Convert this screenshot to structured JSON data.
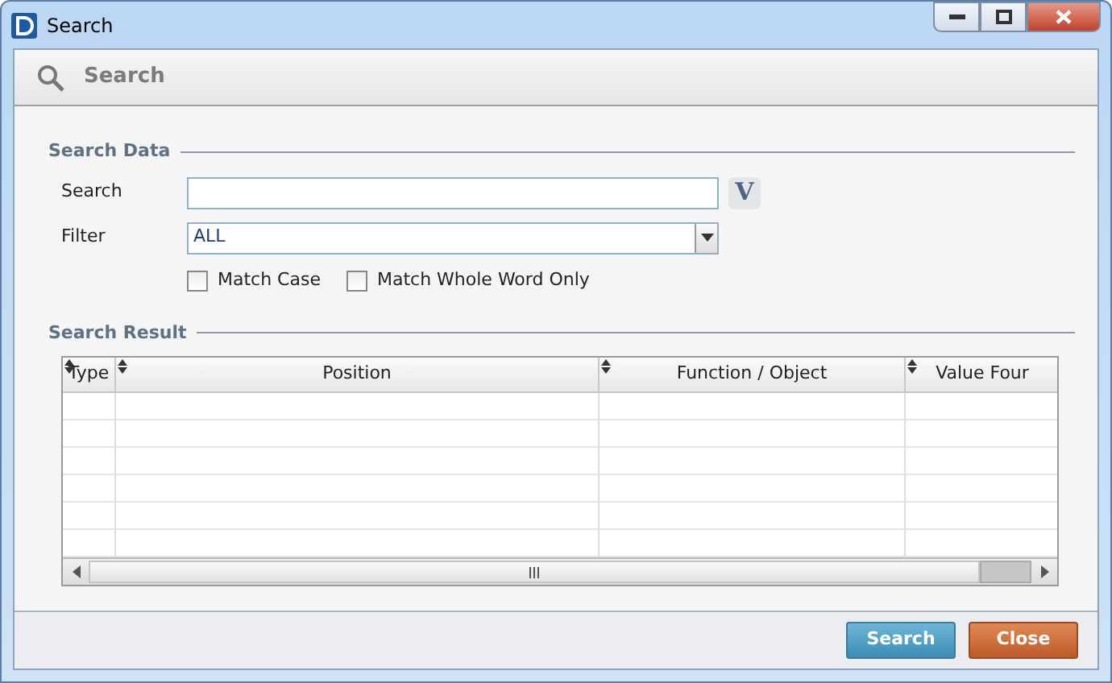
{
  "window": {
    "title": "Search"
  },
  "header": {
    "title": "Search"
  },
  "search_data": {
    "title": "Search Data",
    "search": {
      "label": "Search",
      "button": "V"
    },
    "filter": {
      "label": "Filter",
      "value": "ALL"
    },
    "checkboxes": [
      {
        "label": "Match Case",
        "checked": false
      },
      {
        "label": "Match Whole Word Only",
        "checked": false
      }
    ]
  },
  "search_result": {
    "title": "Search Result",
    "columns": [
      "Type",
      "Position",
      "Function / Object",
      "Value Four"
    ]
  },
  "buttons": [
    {
      "label": "Search",
      "kind": "primary"
    },
    {
      "label": "Close",
      "kind": "danger"
    }
  ]
}
